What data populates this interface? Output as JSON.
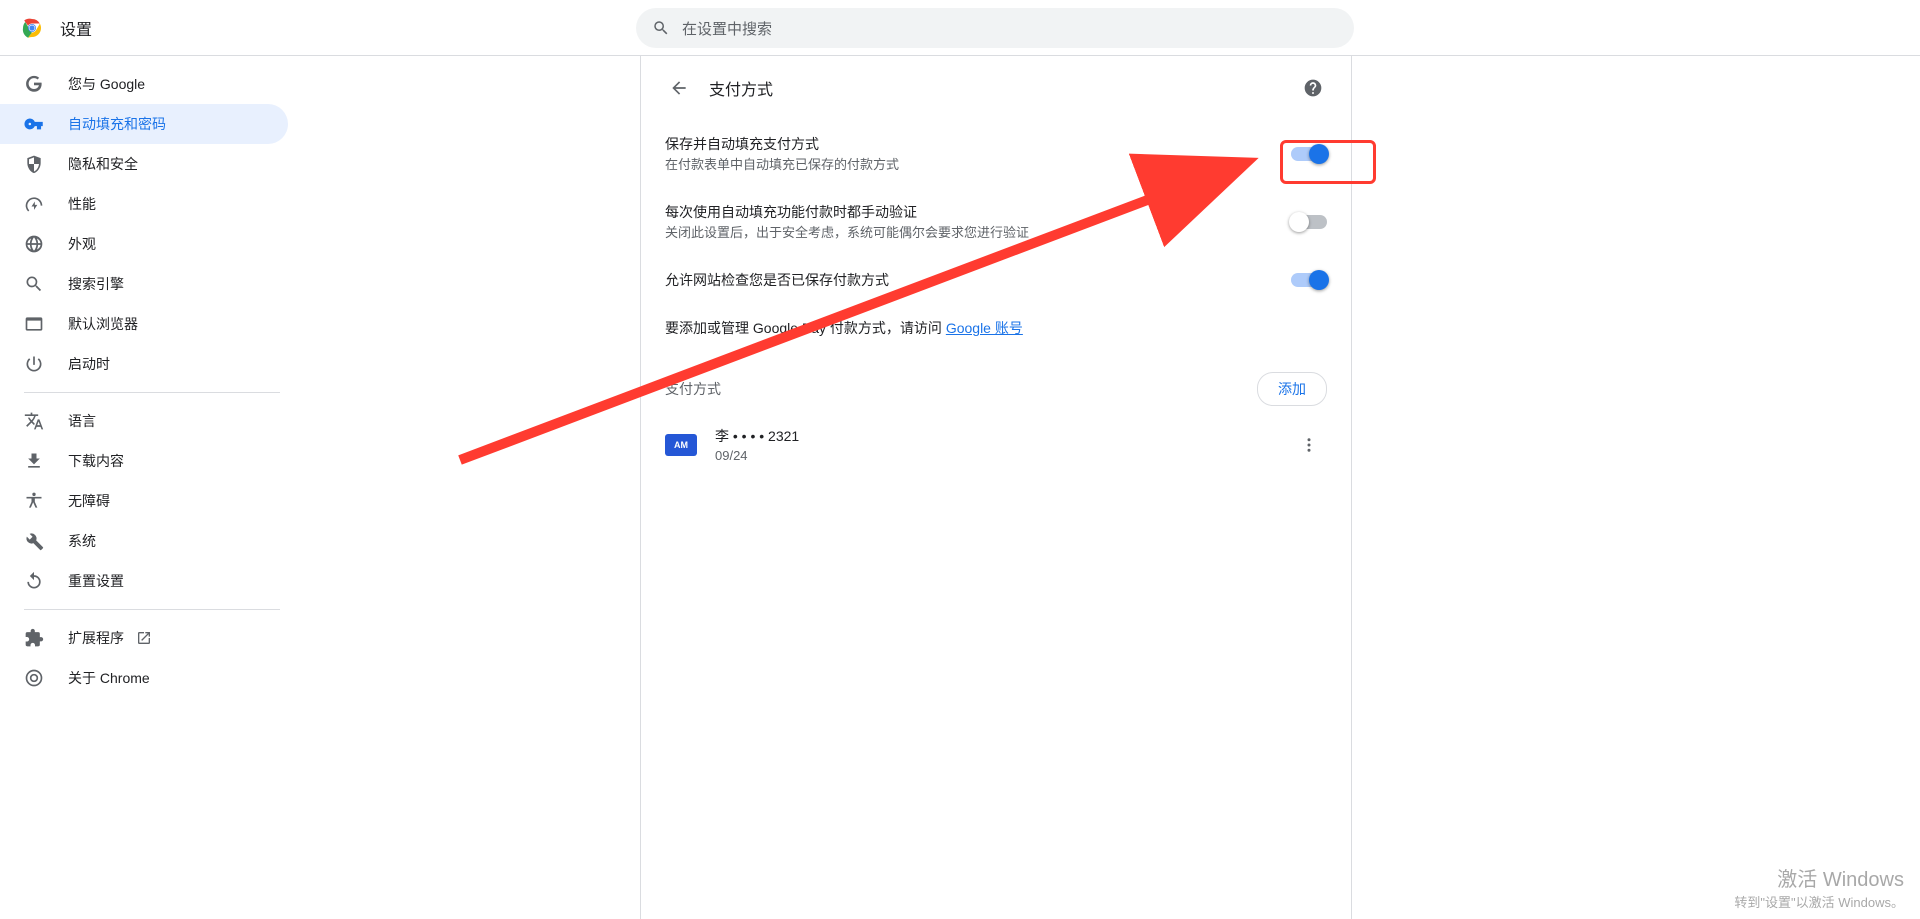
{
  "topbar": {
    "title": "设置",
    "search_placeholder": "在设置中搜索"
  },
  "sidebar": {
    "items": [
      {
        "label": "您与 Google"
      },
      {
        "label": "自动填充和密码"
      },
      {
        "label": "隐私和安全"
      },
      {
        "label": "性能"
      },
      {
        "label": "外观"
      },
      {
        "label": "搜索引擎"
      },
      {
        "label": "默认浏览器"
      },
      {
        "label": "启动时"
      },
      {
        "label": "语言"
      },
      {
        "label": "下载内容"
      },
      {
        "label": "无障碍"
      },
      {
        "label": "系统"
      },
      {
        "label": "重置设置"
      },
      {
        "label": "扩展程序"
      },
      {
        "label": "关于 Chrome"
      }
    ]
  },
  "page": {
    "header_title": "支付方式",
    "rows": {
      "save_fill": {
        "title": "保存并自动填充支付方式",
        "sub": "在付款表单中自动填充已保存的付款方式"
      },
      "verify": {
        "title": "每次使用自动填充功能付款时都手动验证",
        "sub": "关闭此设置后，出于安全考虑，系统可能偶尔会要求您进行验证"
      },
      "allow": {
        "title": "允许网站检查您是否已保存付款方式"
      },
      "gpay": {
        "prefix": "要添加或管理 Google Pay 付款方式，请访问 ",
        "link": "Google 账号"
      }
    },
    "section": {
      "title": "支付方式",
      "add_label": "添加"
    },
    "card": {
      "name": "李 • • • • 2321",
      "expiry": "09/24",
      "brand_short": "AM"
    }
  },
  "watermark": {
    "line1": "激活 Windows",
    "line2": "转到\"设置\"以激活 Windows。"
  }
}
